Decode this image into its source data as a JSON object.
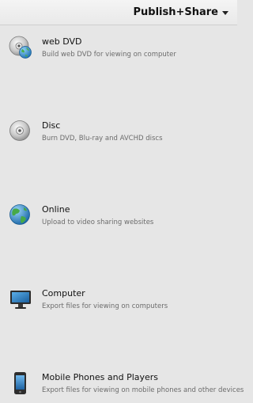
{
  "header": {
    "title": "Publish+Share",
    "dropdown_icon": "chevron-down-icon"
  },
  "items": [
    {
      "label": "web DVD",
      "description": "Build web DVD for viewing on computer",
      "icon": "disc-globe-icon"
    },
    {
      "label": "Disc",
      "description": "Burn DVD, Blu-ray and AVCHD discs",
      "icon": "disc-icon"
    },
    {
      "label": "Online",
      "description": "Upload to video sharing websites",
      "icon": "globe-icon"
    },
    {
      "label": "Computer",
      "description": "Export files for viewing on computers",
      "icon": "monitor-icon"
    },
    {
      "label": "Mobile Phones and Players",
      "description": "Export files for viewing on mobile phones and other devices",
      "icon": "mobile-phone-icon"
    }
  ]
}
